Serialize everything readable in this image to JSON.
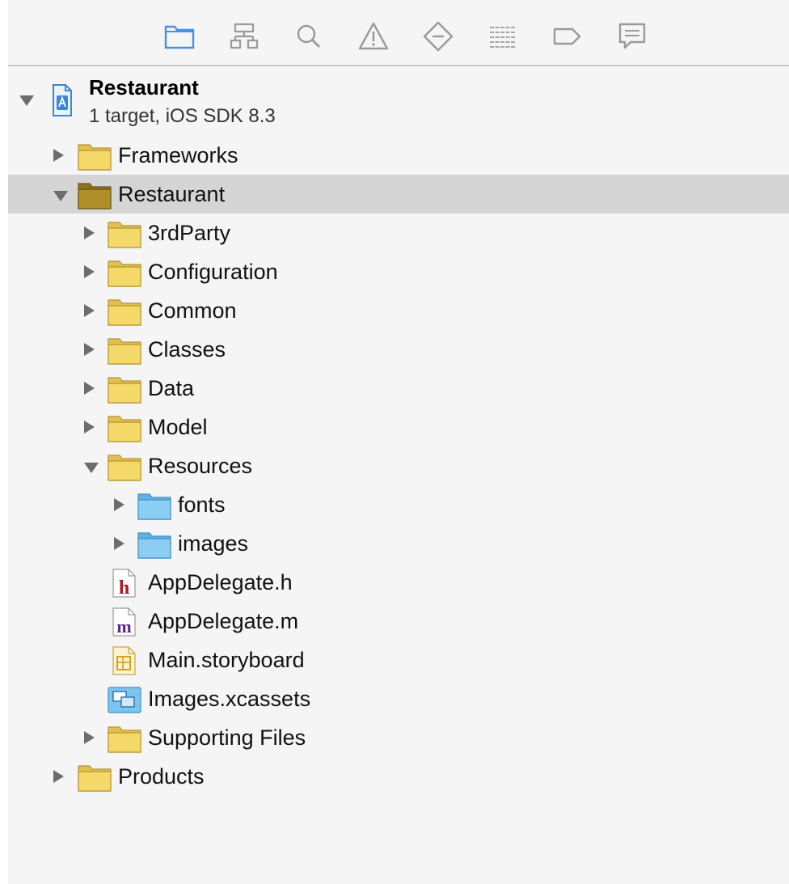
{
  "toolbar": {
    "buttons": [
      {
        "name": "project-navigator",
        "icon": "folder-icon",
        "active": true
      },
      {
        "name": "symbol-navigator",
        "icon": "hierarchy-icon",
        "active": false
      },
      {
        "name": "find-navigator",
        "icon": "magnifier-icon",
        "active": false
      },
      {
        "name": "issue-navigator",
        "icon": "warning-icon",
        "active": false
      },
      {
        "name": "test-navigator",
        "icon": "diamond-minus-icon",
        "active": false
      },
      {
        "name": "debug-navigator",
        "icon": "gauge-lines-icon",
        "active": false
      },
      {
        "name": "breakpoint-navigator",
        "icon": "breakpoint-tag-icon",
        "active": false
      },
      {
        "name": "report-navigator",
        "icon": "speech-bubble-icon",
        "active": false
      }
    ],
    "active_color": "#4a90e2",
    "inactive_color": "#9a9a9a"
  },
  "project": {
    "name": "Restaurant",
    "subtitle": "1 target, iOS SDK 8.3",
    "icon": "xcode-project-icon",
    "expanded": true
  },
  "tree": [
    {
      "label": "Frameworks",
      "depth": 1,
      "disclosure": "closed",
      "icon": "yellow-folder-icon",
      "selected": false
    },
    {
      "label": "Restaurant",
      "depth": 1,
      "disclosure": "open",
      "icon": "yellow-folder-icon",
      "selected": true
    },
    {
      "label": "3rdParty",
      "depth": 2,
      "disclosure": "closed",
      "icon": "yellow-folder-icon",
      "selected": false
    },
    {
      "label": "Configuration",
      "depth": 2,
      "disclosure": "closed",
      "icon": "yellow-folder-icon",
      "selected": false
    },
    {
      "label": "Common",
      "depth": 2,
      "disclosure": "closed",
      "icon": "yellow-folder-icon",
      "selected": false
    },
    {
      "label": "Classes",
      "depth": 2,
      "disclosure": "closed",
      "icon": "yellow-folder-icon",
      "selected": false
    },
    {
      "label": "Data",
      "depth": 2,
      "disclosure": "closed",
      "icon": "yellow-folder-icon",
      "selected": false
    },
    {
      "label": "Model",
      "depth": 2,
      "disclosure": "closed",
      "icon": "yellow-folder-icon",
      "selected": false
    },
    {
      "label": "Resources",
      "depth": 2,
      "disclosure": "open",
      "icon": "yellow-folder-icon",
      "selected": false
    },
    {
      "label": "fonts",
      "depth": 3,
      "disclosure": "closed",
      "icon": "blue-folder-icon",
      "selected": false
    },
    {
      "label": "images",
      "depth": 3,
      "disclosure": "closed",
      "icon": "blue-folder-icon",
      "selected": false
    },
    {
      "label": "AppDelegate.h",
      "depth": 2,
      "disclosure": "none",
      "icon": "header-file-icon",
      "selected": false
    },
    {
      "label": "AppDelegate.m",
      "depth": 2,
      "disclosure": "none",
      "icon": "implementation-file-icon",
      "selected": false
    },
    {
      "label": "Main.storyboard",
      "depth": 2,
      "disclosure": "none",
      "icon": "storyboard-file-icon",
      "selected": false
    },
    {
      "label": "Images.xcassets",
      "depth": 2,
      "disclosure": "none",
      "icon": "asset-catalog-icon",
      "selected": false
    },
    {
      "label": "Supporting Files",
      "depth": 2,
      "disclosure": "closed",
      "icon": "yellow-folder-icon",
      "selected": false
    },
    {
      "label": "Products",
      "depth": 1,
      "disclosure": "closed",
      "icon": "yellow-folder-icon",
      "selected": false
    }
  ]
}
